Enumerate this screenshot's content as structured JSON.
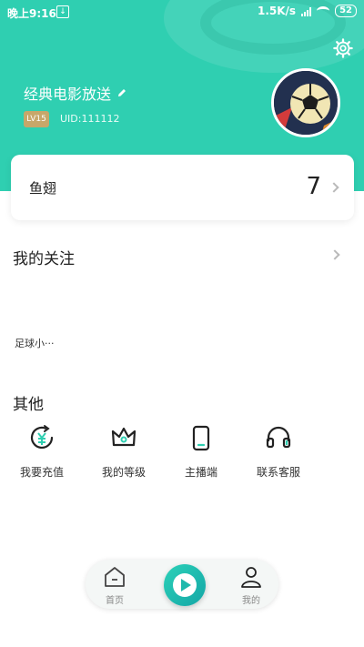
{
  "status_bar": {
    "time": "晚上9:16",
    "speed": "1.5K/s",
    "battery": "52"
  },
  "colors": {
    "accent": "#2fcfb1",
    "badge": "#c7a76a"
  },
  "profile": {
    "name": "经典电影放送",
    "level": "LV15",
    "uid": "UID:111112"
  },
  "fin_card": {
    "label": "鱼翅",
    "value": "7"
  },
  "following": {
    "title": "我的关注",
    "items": [
      "足球小···"
    ]
  },
  "others": {
    "title": "其他",
    "items": [
      {
        "label": "我要充值",
        "icon": "recharge-icon"
      },
      {
        "label": "我的等级",
        "icon": "crown-icon"
      },
      {
        "label": "主播端",
        "icon": "phone-icon"
      },
      {
        "label": "联系客服",
        "icon": "headset-icon"
      }
    ]
  },
  "nav": {
    "home": "首页",
    "mine": "我的"
  }
}
